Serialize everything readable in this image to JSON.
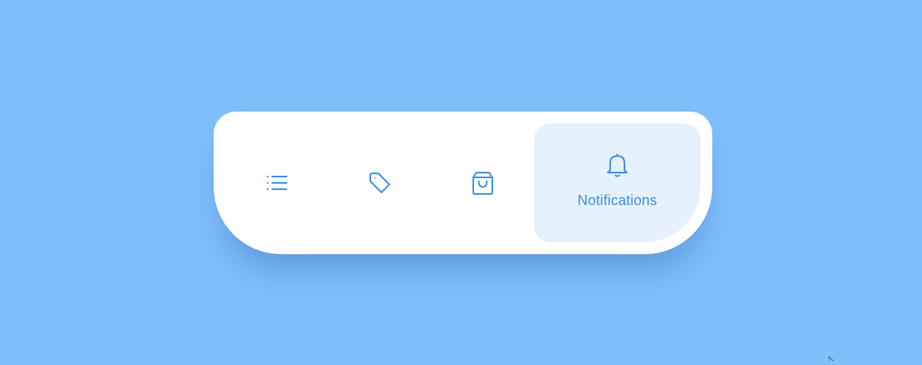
{
  "colors": {
    "background": "#7fbffc",
    "card": "#ffffff",
    "accent": "#3d8fe0",
    "active_item_bg": "#e5f2fd"
  },
  "nav": {
    "items": [
      {
        "id": "menu",
        "icon": "list-icon",
        "label": ""
      },
      {
        "id": "tags",
        "icon": "tag-icon",
        "label": ""
      },
      {
        "id": "shop",
        "icon": "shopping-bag-icon",
        "label": ""
      },
      {
        "id": "notifications",
        "icon": "bell-icon",
        "label": "Notifications",
        "active": true
      }
    ]
  }
}
